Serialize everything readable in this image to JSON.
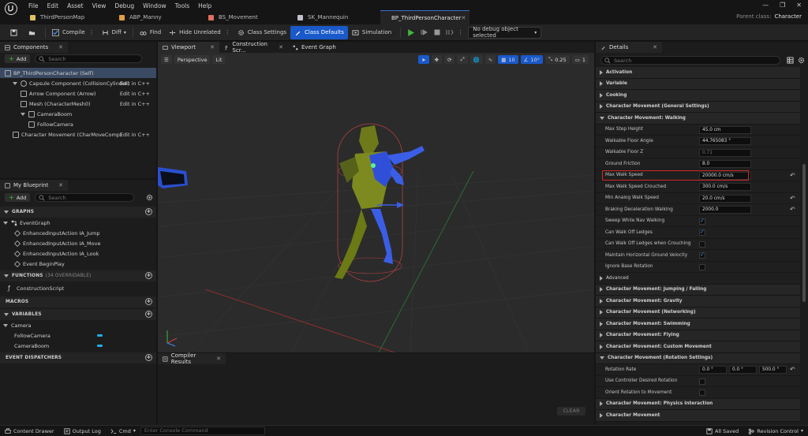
{
  "menu": [
    "File",
    "Edit",
    "Asset",
    "View",
    "Debug",
    "Window",
    "Tools",
    "Help"
  ],
  "doc_tabs": [
    {
      "label": "ThirdPersonMap",
      "icon": "level-icon",
      "active": false
    },
    {
      "label": "ABP_Manny",
      "icon": "anim-blueprint-icon",
      "active": false
    },
    {
      "label": "BS_Movement",
      "icon": "blendspace-icon",
      "active": false
    },
    {
      "label": "SK_Mannequin",
      "icon": "skeleton-icon",
      "active": false
    },
    {
      "label": "BP_ThirdPersonCharacter",
      "icon": "blueprint-icon",
      "active": true
    }
  ],
  "parent_class": {
    "label": "Parent class:",
    "value": "Character"
  },
  "toolbar": {
    "compile": "Compile",
    "diff": "Diff",
    "find": "Find",
    "hide_unrelated": "Hide Unrelated",
    "class_settings": "Class Settings",
    "class_defaults": "Class Defaults",
    "simulation": "Simulation",
    "debug_object": "No debug object selected"
  },
  "components": {
    "tab": "Components",
    "add": "Add",
    "search_placeholder": "Search",
    "items": [
      {
        "label": "BP_ThirdPersonCharacter (Self)",
        "edit": "",
        "depth": 0
      },
      {
        "label": "Capsule Component (CollisionCylinder)",
        "edit": "Edit in C++",
        "depth": 1
      },
      {
        "label": "Arrow Component (Arrow)",
        "edit": "Edit in C++",
        "depth": 2
      },
      {
        "label": "Mesh (CharacterMesh0)",
        "edit": "Edit in C++",
        "depth": 2
      },
      {
        "label": "CameraBoom",
        "edit": "",
        "depth": 2
      },
      {
        "label": "FollowCamera",
        "edit": "",
        "depth": 3
      },
      {
        "label": "Character Movement (CharMoveComp)",
        "edit": "Edit in C++",
        "depth": 1
      }
    ]
  },
  "my_blueprint": {
    "tab": "My Blueprint",
    "add": "Add",
    "search_placeholder": "Search",
    "graphs_label": "GRAPHS",
    "event_graph": "EventGraph",
    "events": [
      "EnhancedInputAction IA_Jump",
      "EnhancedInputAction IA_Move",
      "EnhancedInputAction IA_Look",
      "Event BeginPlay"
    ],
    "functions_label": "FUNCTIONS",
    "functions_count": "(34 OVERRIDABLE)",
    "functions": [
      "ConstructionScript"
    ],
    "macros_label": "MACROS",
    "variables_label": "VARIABLES",
    "var_category": "Camera",
    "variables": [
      "FollowCamera",
      "CameraBoom"
    ],
    "dispatchers_label": "EVENT DISPATCHERS"
  },
  "center_tabs": [
    "Viewport",
    "Construction Scr...",
    "Event Graph"
  ],
  "viewport": {
    "perspective": "Perspective",
    "lit": "Lit",
    "grid_snap": "10",
    "rot_snap": "10°",
    "scale_snap": "0.25",
    "cam_speed": "1"
  },
  "compiler": {
    "tab": "Compiler Results",
    "clear": "CLEAR"
  },
  "details": {
    "tab": "Details",
    "search_placeholder": "Search",
    "rows": [
      {
        "kind": "cat",
        "label": "Activation",
        "open": false
      },
      {
        "kind": "cat",
        "label": "Variable",
        "open": false
      },
      {
        "kind": "cat",
        "label": "Cooking",
        "open": false
      },
      {
        "kind": "cat",
        "label": "Character Movement (General Settings)",
        "open": false
      },
      {
        "kind": "cat",
        "label": "Character Movement: Walking",
        "open": true
      },
      {
        "kind": "val",
        "label": "Max Step Height",
        "value": "45.0 cm"
      },
      {
        "kind": "val",
        "label": "Walkable Floor Angle",
        "value": "44.765083 °"
      },
      {
        "kind": "val",
        "label": "Walkable Floor Z",
        "value": "0.71",
        "dim": true
      },
      {
        "kind": "val",
        "label": "Ground Friction",
        "value": "8.0"
      },
      {
        "kind": "val",
        "label": "Max Walk Speed",
        "value": "20000.0 cm/s",
        "highlight": true,
        "reset": true
      },
      {
        "kind": "val",
        "label": "Max Walk Speed Crouched",
        "value": "300.0 cm/s"
      },
      {
        "kind": "val",
        "label": "Min Analog Walk Speed",
        "value": "20.0 cm/s",
        "reset": true
      },
      {
        "kind": "val",
        "label": "Braking Deceleration Walking",
        "value": "2000.0",
        "reset": true
      },
      {
        "kind": "chk",
        "label": "Sweep While Nav Walking",
        "checked": true
      },
      {
        "kind": "chk",
        "label": "Can Walk Off Ledges",
        "checked": true
      },
      {
        "kind": "chk",
        "label": "Can Walk Off Ledges when Crouching",
        "checked": false
      },
      {
        "kind": "chk",
        "label": "Maintain Horizontal Ground Velocity",
        "checked": true
      },
      {
        "kind": "chk",
        "label": "Ignore Base Rotation",
        "checked": false
      },
      {
        "kind": "cat",
        "label": "Advanced",
        "open": false,
        "plain": true
      },
      {
        "kind": "cat",
        "label": "Character Movement: Jumping / Falling",
        "open": false
      },
      {
        "kind": "cat",
        "label": "Character Movement: Gravity",
        "open": false
      },
      {
        "kind": "cat",
        "label": "Character Movement (Networking)",
        "open": false
      },
      {
        "kind": "cat",
        "label": "Character Movement: Swimming",
        "open": false
      },
      {
        "kind": "cat",
        "label": "Character Movement: Flying",
        "open": false
      },
      {
        "kind": "cat",
        "label": "Character Movement: Custom Movement",
        "open": false
      },
      {
        "kind": "cat",
        "label": "Character Movement (Rotation Settings)",
        "open": true
      },
      {
        "kind": "rot",
        "label": "Rotation Rate",
        "values": [
          "0.0 °",
          "0.0 °",
          "500.0 °"
        ],
        "reset": true
      },
      {
        "kind": "chk",
        "label": "Use Controller Desired Rotation",
        "checked": false
      },
      {
        "kind": "chk",
        "label": "Orient Rotation to Movement",
        "checked": false
      },
      {
        "kind": "cat",
        "label": "Character Movement: Physics Interaction",
        "open": false
      },
      {
        "kind": "cat",
        "label": "Character Movement",
        "open": false
      }
    ]
  },
  "status": {
    "content_drawer": "Content Drawer",
    "output_log": "Output Log",
    "cmd": "Cmd",
    "console_placeholder": "Enter Console Command",
    "saved": "All Saved",
    "revision": "Revision Control"
  },
  "colors": {
    "accent": "#1a59c9",
    "highlight_border": "#d02a2a",
    "check": "#3c8ff0",
    "add_plus": "#36c236"
  }
}
